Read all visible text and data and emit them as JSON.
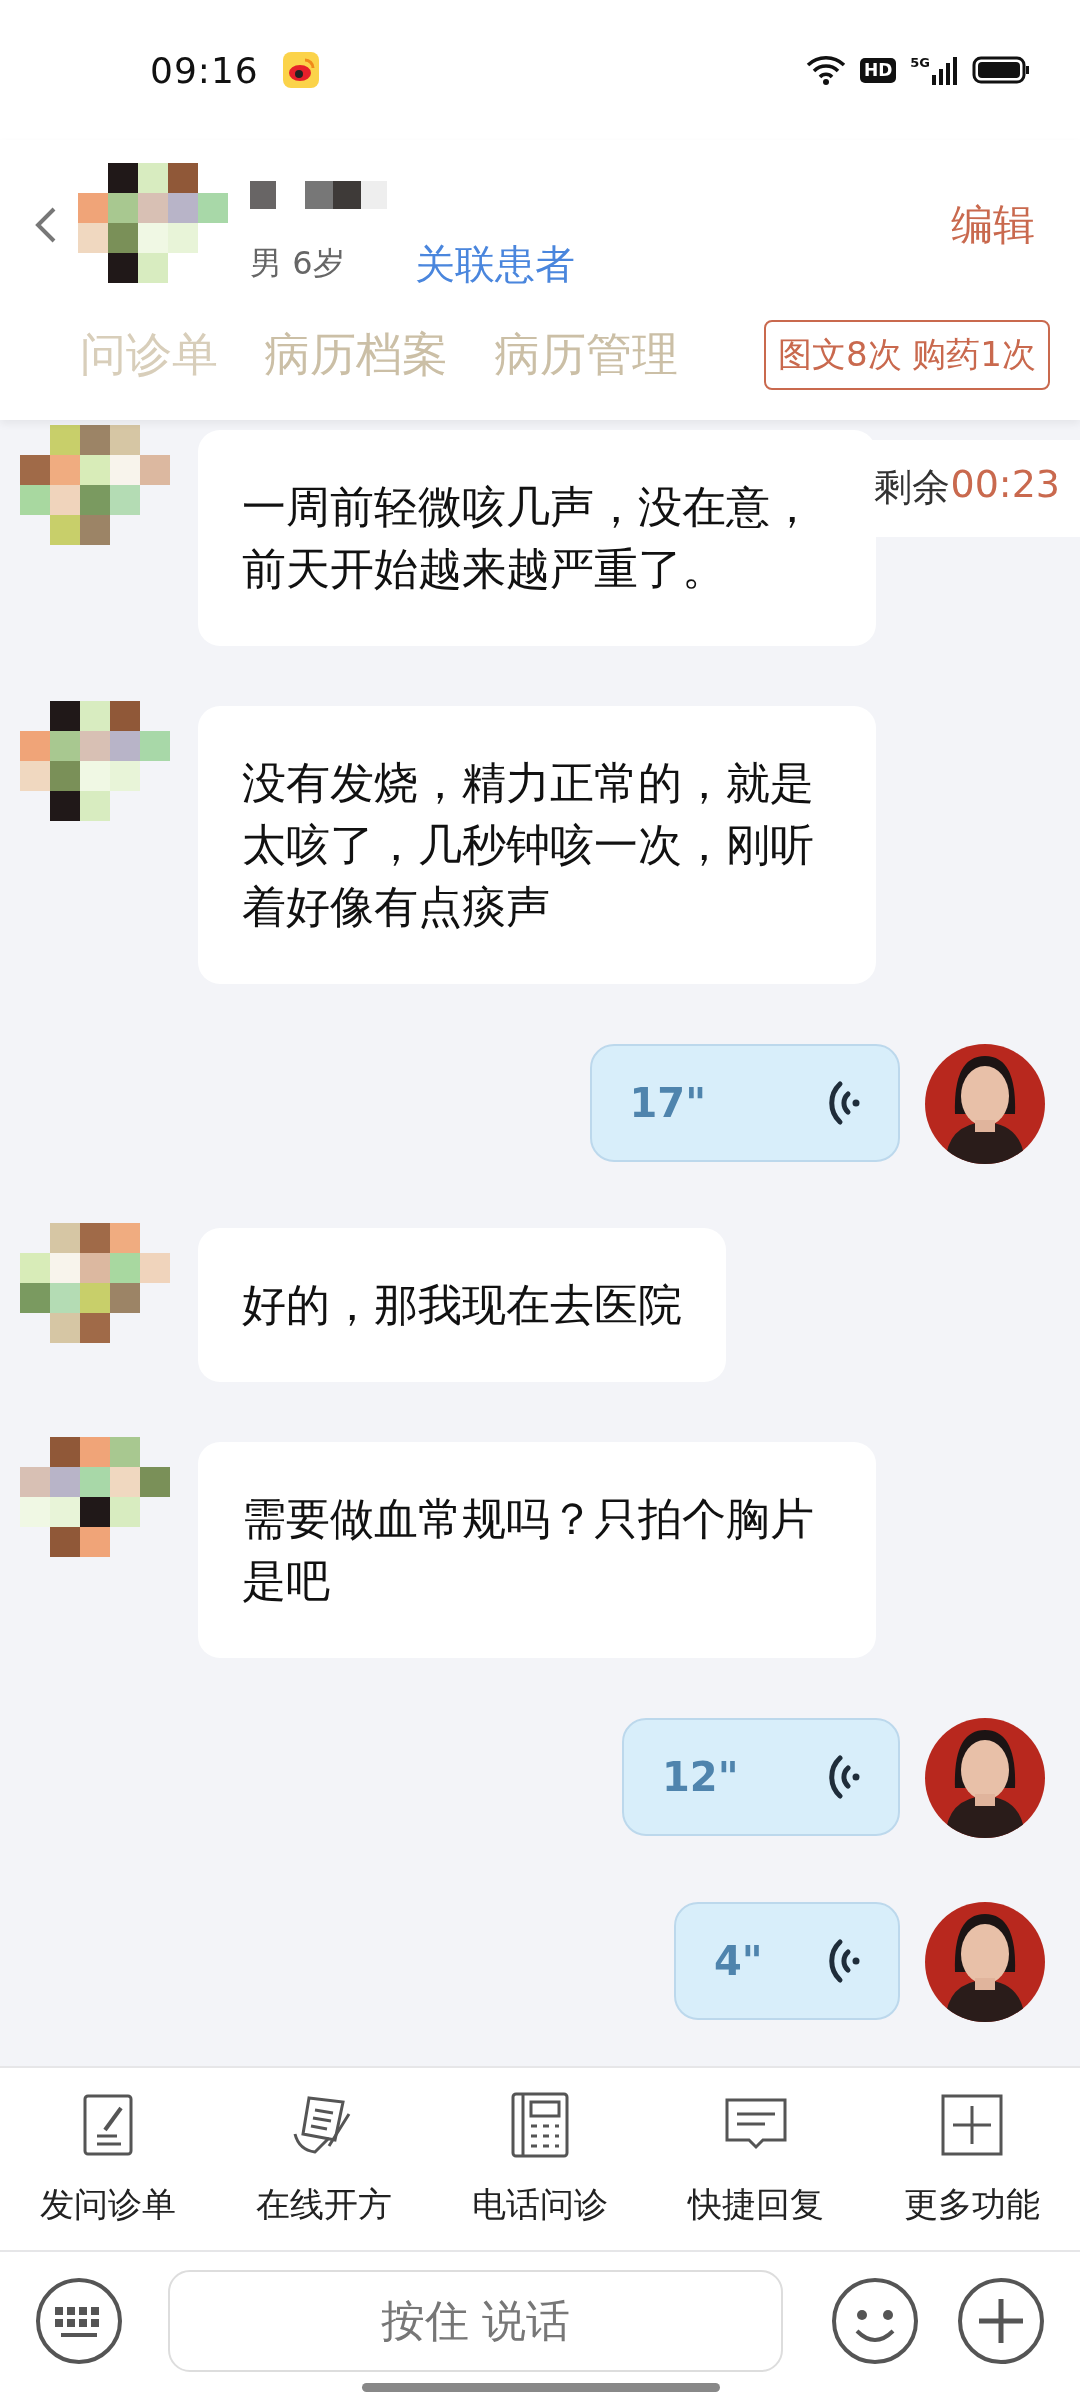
{
  "status_bar": {
    "time": "09:16",
    "hd": "HD",
    "network": "5G"
  },
  "header": {
    "gender_age": "男 6岁",
    "link": "关联患者",
    "edit": "编辑"
  },
  "tabs": [
    {
      "label": "问诊单"
    },
    {
      "label": "病历档案"
    },
    {
      "label": "病历管理"
    }
  ],
  "usage_badge": "图文8次 购药1次",
  "timer": {
    "label": "剩余",
    "value": "00:23"
  },
  "messages": [
    {
      "kind": "text",
      "text": "一周前轻微咳几声，没在意，前天开始越来越严重了。"
    },
    {
      "kind": "text",
      "text": "没有发烧，精力正常的，就是太咳了，几秒钟咳一次，刚听着好像有点痰声"
    },
    {
      "kind": "voice",
      "duration": "17\""
    },
    {
      "kind": "text",
      "text": "好的，那我现在去医院"
    },
    {
      "kind": "text",
      "text": "需要做血常规吗？只拍个胸片是吧"
    },
    {
      "kind": "voice",
      "duration": "12\""
    },
    {
      "kind": "voice",
      "duration": "4\""
    }
  ],
  "toolbar": [
    {
      "kind": "form",
      "label": "发问诊单"
    },
    {
      "kind": "prescription",
      "label": "在线开方"
    },
    {
      "kind": "phone",
      "label": "电话问诊"
    },
    {
      "kind": "reply",
      "label": "快捷回复"
    },
    {
      "kind": "more",
      "label": "更多功能"
    }
  ],
  "input": {
    "label": "按住 说话"
  }
}
